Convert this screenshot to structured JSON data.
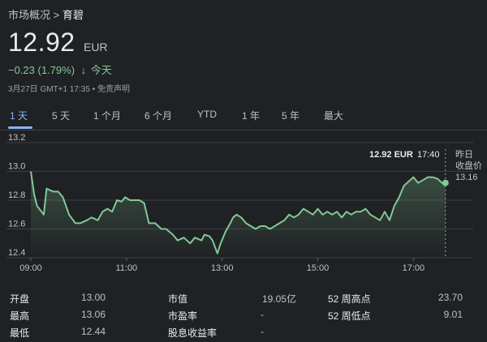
{
  "breadcrumb": {
    "parent": "市场概况",
    "separator": ">",
    "current": "育碧"
  },
  "quote": {
    "price": "12.92",
    "currency": "EUR",
    "change": "−0.23 (1.79%)",
    "arrow": "↓",
    "period": "今天"
  },
  "meta": "3月27日 GMT+1 17:35 • 免责声明",
  "tabs": [
    {
      "label": "1 天",
      "active": true
    },
    {
      "label": "5 天",
      "active": false
    },
    {
      "label": "1 个月",
      "active": false
    },
    {
      "label": "6 个月",
      "active": false
    },
    {
      "label": "YTD",
      "active": false
    },
    {
      "label": "1 年",
      "active": false
    },
    {
      "label": "5 年",
      "active": false
    },
    {
      "label": "最大",
      "active": false
    }
  ],
  "tooltip": {
    "price": "12.92 EUR",
    "time": "17:40"
  },
  "prev_close": {
    "label_line1": "昨日",
    "label_line2": "收盘价",
    "value": "13.16"
  },
  "colors": {
    "line": "#81c995",
    "accent": "#8ab4f8",
    "background": "#202124"
  },
  "chart_data": {
    "type": "area",
    "ylim": [
      12.4,
      13.2
    ],
    "y_ticks": [
      "13.2",
      "13.0",
      "12.8",
      "12.6",
      "12.4"
    ],
    "x_ticks": [
      "09:00",
      "11:00",
      "13:00",
      "15:00",
      "17:00"
    ],
    "x_domain_hours": [
      9,
      18.25
    ],
    "prev_close": 13.16,
    "series": [
      {
        "x": [
          9.0,
          9.07,
          9.13,
          9.27,
          9.33,
          9.47,
          9.57,
          9.67,
          9.8,
          9.93,
          10.03,
          10.17,
          10.27,
          10.4,
          10.5,
          10.6,
          10.7,
          10.8,
          10.9,
          10.97,
          11.07,
          11.17,
          11.27,
          11.37,
          11.47,
          11.6,
          11.73,
          11.83,
          11.97,
          12.07,
          12.2,
          12.33,
          12.43,
          12.57,
          12.63,
          12.73,
          12.8,
          12.9,
          12.97,
          13.07,
          13.17,
          13.23,
          13.3,
          13.4,
          13.5,
          13.6,
          13.7,
          13.8,
          13.9,
          14.0,
          14.1,
          14.2,
          14.3,
          14.4,
          14.5,
          14.6,
          14.7,
          14.8,
          14.9,
          15.0,
          15.1,
          15.2,
          15.3,
          15.4,
          15.5,
          15.6,
          15.7,
          15.8,
          15.9,
          16.0,
          16.1,
          16.2,
          16.3,
          16.4,
          16.5,
          16.6,
          16.7,
          16.8,
          16.9,
          17.0,
          17.1,
          17.2,
          17.3,
          17.4,
          17.5,
          17.6,
          17.67
        ],
        "y": [
          13.0,
          12.84,
          12.76,
          12.7,
          12.88,
          12.86,
          12.86,
          12.82,
          12.7,
          12.64,
          12.64,
          12.66,
          12.68,
          12.66,
          12.72,
          12.74,
          12.72,
          12.8,
          12.79,
          12.82,
          12.8,
          12.8,
          12.8,
          12.78,
          12.64,
          12.64,
          12.6,
          12.6,
          12.56,
          12.52,
          12.54,
          12.5,
          12.54,
          12.52,
          12.56,
          12.55,
          12.52,
          12.43,
          12.5,
          12.58,
          12.64,
          12.68,
          12.7,
          12.68,
          12.64,
          12.62,
          12.6,
          12.62,
          12.62,
          12.6,
          12.62,
          12.64,
          12.66,
          12.7,
          12.68,
          12.7,
          12.74,
          12.72,
          12.7,
          12.74,
          12.7,
          12.72,
          12.7,
          12.72,
          12.68,
          12.72,
          12.7,
          12.72,
          12.72,
          12.74,
          12.7,
          12.68,
          12.66,
          12.72,
          12.66,
          12.76,
          12.82,
          12.9,
          12.93,
          12.96,
          12.92,
          12.94,
          12.96,
          12.96,
          12.95,
          12.92,
          12.92
        ]
      }
    ]
  },
  "stats": {
    "col1": [
      {
        "label": "开盘",
        "value": "13.00"
      },
      {
        "label": "最高",
        "value": "13.06"
      },
      {
        "label": "最低",
        "value": "12.44"
      }
    ],
    "col2": [
      {
        "label": "市值",
        "value": "19.05亿"
      },
      {
        "label": "市盈率",
        "value": "-"
      },
      {
        "label": "股息收益率",
        "value": "-"
      }
    ],
    "col3": [
      {
        "label": "52 周高点",
        "value": "23.70"
      },
      {
        "label": "52 周低点",
        "value": "9.01"
      }
    ]
  }
}
